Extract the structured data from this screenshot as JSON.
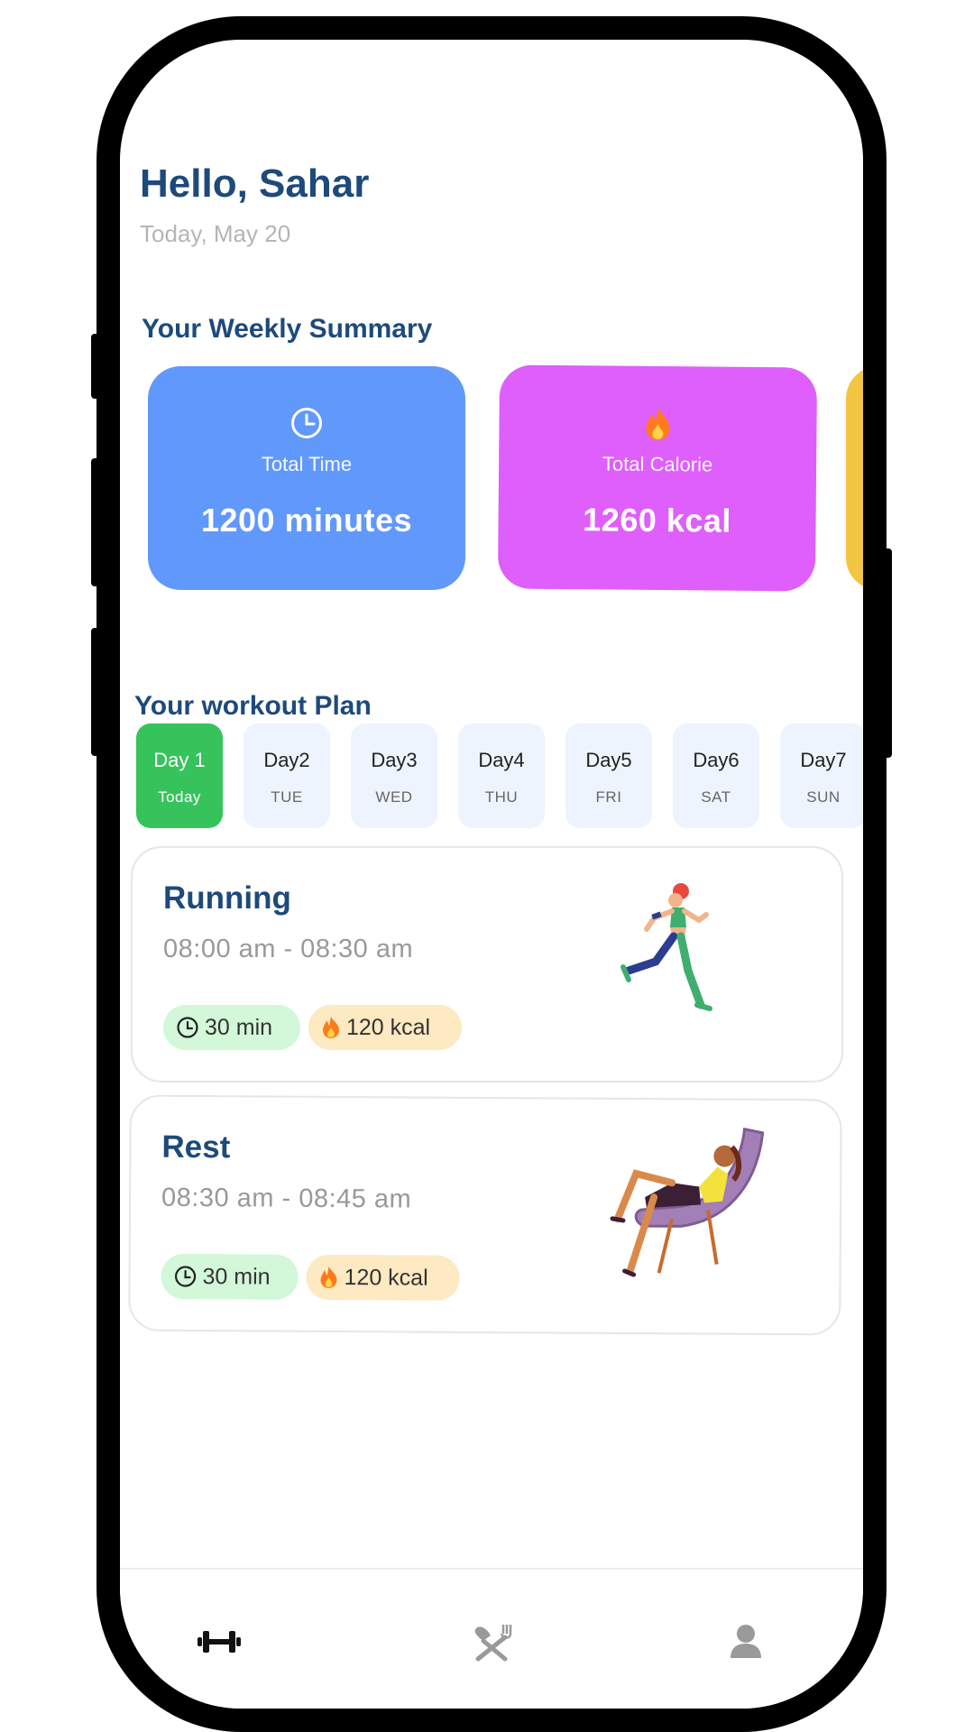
{
  "header": {
    "greeting": "Hello, Sahar",
    "date": "Today, May 20"
  },
  "summary": {
    "title": "Your Weekly Summary",
    "cards": [
      {
        "icon": "clock-icon",
        "label": "Total Time",
        "value": "1200 minutes",
        "color": "#6198fc"
      },
      {
        "icon": "fire-icon",
        "label": "Total Calorie",
        "value": "1260  kcal",
        "color": "#de5ffb"
      },
      {
        "icon": "",
        "label": "",
        "value": "",
        "color": "#f2c641"
      }
    ]
  },
  "plan": {
    "title": "Your workout Plan",
    "days": [
      {
        "label": "Day 1",
        "sub": "Today",
        "active": true
      },
      {
        "label": "Day2",
        "sub": "TUE",
        "active": false
      },
      {
        "label": "Day3",
        "sub": "WED",
        "active": false
      },
      {
        "label": "Day4",
        "sub": "THU",
        "active": false
      },
      {
        "label": "Day5",
        "sub": "FRI",
        "active": false
      },
      {
        "label": "Day6",
        "sub": "SAT",
        "active": false
      },
      {
        "label": "Day7",
        "sub": "SUN",
        "active": false
      }
    ],
    "active_color": "#36c35c"
  },
  "workouts": [
    {
      "title": "Running",
      "time": "08:00 am - 08:30 am",
      "duration": "30 min",
      "calories": "120 kcal",
      "illustration": "runner-illustration"
    },
    {
      "title": "Rest",
      "time": "08:30 am - 08:45 am",
      "duration": "30 min",
      "calories": "120 kcal",
      "illustration": "resting-illustration"
    }
  ],
  "nav": {
    "items": [
      {
        "icon": "dumbbell-icon",
        "active": true
      },
      {
        "icon": "fork-knife-icon",
        "active": false
      },
      {
        "icon": "profile-icon",
        "active": false
      }
    ]
  },
  "colors": {
    "title": "#1d4a7b",
    "chip_green": "#d3f7d9",
    "chip_yellow": "#fde9c2"
  }
}
